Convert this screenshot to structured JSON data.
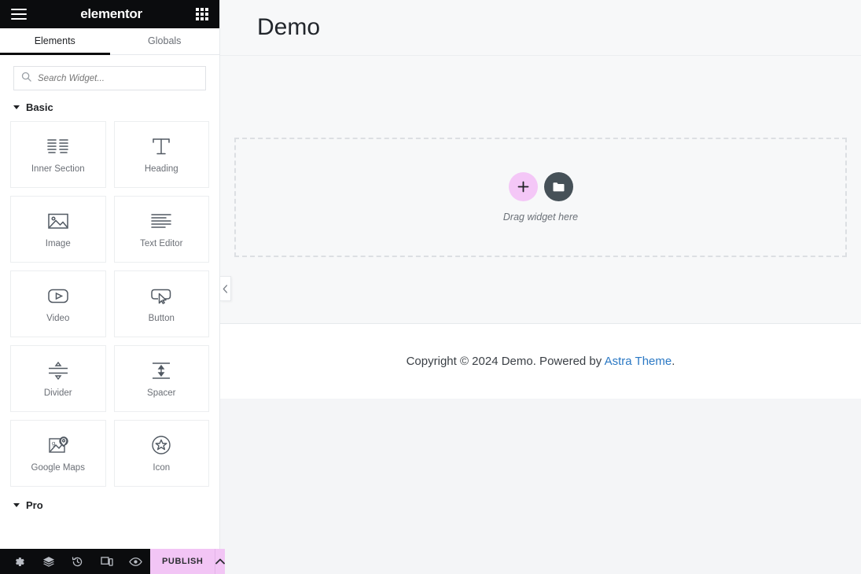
{
  "panel": {
    "brand": "elementor",
    "icons": {
      "menu": "hamburger-menu-icon",
      "apps": "app-grid-icon"
    },
    "tabs": [
      {
        "label": "Elements",
        "active": true
      },
      {
        "label": "Globals",
        "active": false
      }
    ],
    "search": {
      "placeholder": "Search Widget...",
      "value": "",
      "icon": "search-icon"
    },
    "sections": [
      {
        "title": "Basic",
        "expanded": true
      },
      {
        "title": "Pro",
        "expanded": true
      }
    ],
    "widgets": [
      {
        "label": "Inner Section",
        "icon": "columns-icon"
      },
      {
        "label": "Heading",
        "icon": "heading-t-icon"
      },
      {
        "label": "Image",
        "icon": "image-icon"
      },
      {
        "label": "Text Editor",
        "icon": "text-lines-icon"
      },
      {
        "label": "Video",
        "icon": "video-play-icon"
      },
      {
        "label": "Button",
        "icon": "button-cursor-icon"
      },
      {
        "label": "Divider",
        "icon": "divider-icon"
      },
      {
        "label": "Spacer",
        "icon": "spacer-arrows-icon"
      },
      {
        "label": "Google Maps",
        "icon": "map-pin-icon"
      },
      {
        "label": "Icon",
        "icon": "star-circle-icon"
      }
    ]
  },
  "bottom_bar": {
    "icons": [
      {
        "name": "settings-gear-icon",
        "title": "Settings"
      },
      {
        "name": "navigator-layers-icon",
        "title": "Navigator"
      },
      {
        "name": "history-clock-icon",
        "title": "History"
      },
      {
        "name": "responsive-mode-icon",
        "title": "Responsive Mode"
      },
      {
        "name": "preview-eye-icon",
        "title": "Preview Changes"
      }
    ],
    "publish_label": "PUBLISH",
    "publish_caret": "chevron-up-icon",
    "publish_color": "#f2c5f5"
  },
  "collapse_handle": {
    "icon": "chevron-left-icon"
  },
  "canvas": {
    "site_title": "Demo",
    "dropzone": {
      "text": "Drag widget here",
      "add_icon": "plus-icon",
      "template_icon": "folder-icon",
      "add_color": "#f4c7f7",
      "template_color": "#465158"
    },
    "footer": {
      "prefix": "Copyright © 2024 Demo. Powered by ",
      "link": "Astra Theme",
      "suffix": ".",
      "link_color": "#2a78c4"
    }
  }
}
